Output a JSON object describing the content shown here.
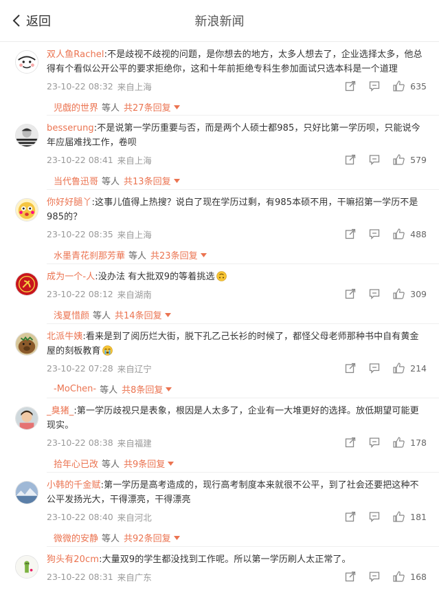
{
  "header": {
    "back_label": "返回",
    "title": "新浪新闻"
  },
  "comments": [
    {
      "user": "双人鱼Rachel",
      "text": ":不是歧视不歧视的问题，是你想去的地方，太多人想去了，企业选择太多，他总得有个看似公开公平的要求拒绝你，这和十年前拒绝专科生参加面试只选本科是一个道理",
      "date": "23-10-22 08:32",
      "location": "来自上海",
      "likes": "635",
      "reply_user": "児戯的世界",
      "reply_mid": "等人",
      "reply_count": "共27条回复",
      "avatar": "cartoon-face"
    },
    {
      "user": "besserung",
      "text": ":不是说第一学历重要与否，而是两个人硕士都985，只好比第一学历呗，只能说今年应届难找工作，卷呗",
      "date": "23-10-22 08:41",
      "location": "来自上海",
      "likes": "579",
      "reply_user": "当代鲁迅哥",
      "reply_mid": "等人",
      "reply_count": "共13条回复",
      "avatar": "striped-person"
    },
    {
      "user": "你好好膼丫",
      "text": ":这事儿值得上热搜？说白了现在学历过剩，有985本硕不用，干嘛招第一学历不是985的？",
      "date": "23-10-22 08:35",
      "location": "来自上海",
      "likes": "488",
      "reply_user": "水墨青花刹那芳華",
      "reply_mid": "等人",
      "reply_count": "共23条回复",
      "avatar": "cartoon-yellow"
    },
    {
      "user": "成为一个-人",
      "text": ":没办法 有大批双9的等着挑选",
      "date": "23-10-22 08:12",
      "location": "来自湖南",
      "likes": "309",
      "reply_user": "浅夏惜颜",
      "reply_mid": "等人",
      "reply_count": "共14条回复",
      "avatar": "red-emblem",
      "emoji": "upside-down-face"
    },
    {
      "user": "北派牛姨",
      "text": ":看来是到了阅历烂大街，脱下孔乙己长衫的时候了，都怪父母老师那种书中自有黄金屋的刻板教育",
      "date": "23-10-22 07:28",
      "location": "来自辽宁",
      "likes": "214",
      "reply_user": "-MoChen-",
      "reply_mid": "等人",
      "reply_count": "共8条回复",
      "avatar": "capybara",
      "emoji": "crying-face"
    },
    {
      "user": "_臭猪_",
      "text": ":第一学历歧视只是表象，根因是人太多了，企业有一大堆更好的选择。放低期望可能更现实。",
      "date": "23-10-22 08:38",
      "location": "来自福建",
      "likes": "178",
      "reply_user": "拾年心已改",
      "reply_mid": "等人",
      "reply_count": "共9条回复",
      "avatar": "child-photo"
    },
    {
      "user": "小韩的千金赋",
      "text": ":第一学历是高考造成的，现行高考制度本来就很不公平，到了社会还要把这种不公平发扬光大，干得漂亮，干得漂亮",
      "date": "23-10-22 08:40",
      "location": "来自河北",
      "likes": "181",
      "reply_user": "微微的安静",
      "reply_mid": "等人",
      "reply_count": "共92条回复",
      "avatar": "landscape"
    },
    {
      "user": "狗头有20cm",
      "text": ":大量双9的学生都没找到工作呢。所以第一学历刷人太正常了。",
      "date": "23-10-22 08:31",
      "location": "来自广东",
      "likes": "168",
      "avatar": "green-figure"
    }
  ]
}
